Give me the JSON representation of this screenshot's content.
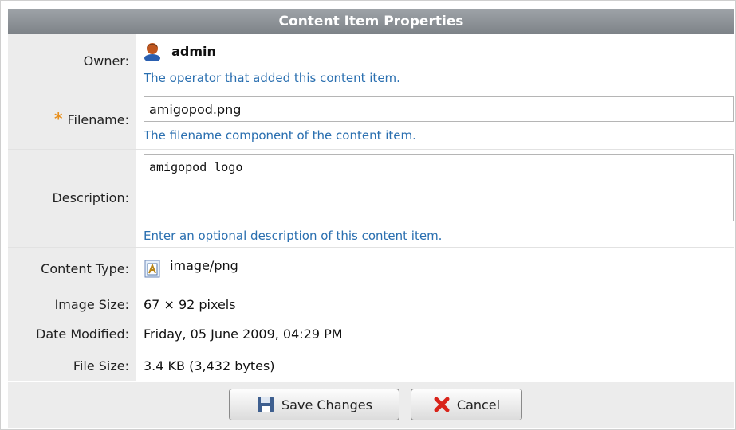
{
  "title": "Content Item Properties",
  "owner": {
    "label": "Owner:",
    "value": "admin",
    "help": "The operator that added this content item.",
    "icon": "user-icon"
  },
  "filename": {
    "label": "Filename:",
    "required_mark": "*",
    "value": "amigopod.png",
    "help": "The filename component of the content item."
  },
  "description": {
    "label": "Description:",
    "value": "amigopod logo",
    "help": "Enter an optional description of this content item."
  },
  "content_type": {
    "label": "Content Type:",
    "value": "image/png",
    "icon": "image-file-icon"
  },
  "image_size": {
    "label": "Image Size:",
    "value": "67 × 92 pixels"
  },
  "date_modified": {
    "label": "Date Modified:",
    "value": "Friday, 05 June 2009, 04:29 PM"
  },
  "file_size": {
    "label": "File Size:",
    "value": "3.4 KB (3,432 bytes)"
  },
  "buttons": {
    "save": "Save Changes",
    "cancel": "Cancel"
  },
  "colors": {
    "help_text": "#2a6fb0",
    "required": "#e8901e",
    "cancel_x": "#d9231a",
    "header": "#8a8f94"
  }
}
